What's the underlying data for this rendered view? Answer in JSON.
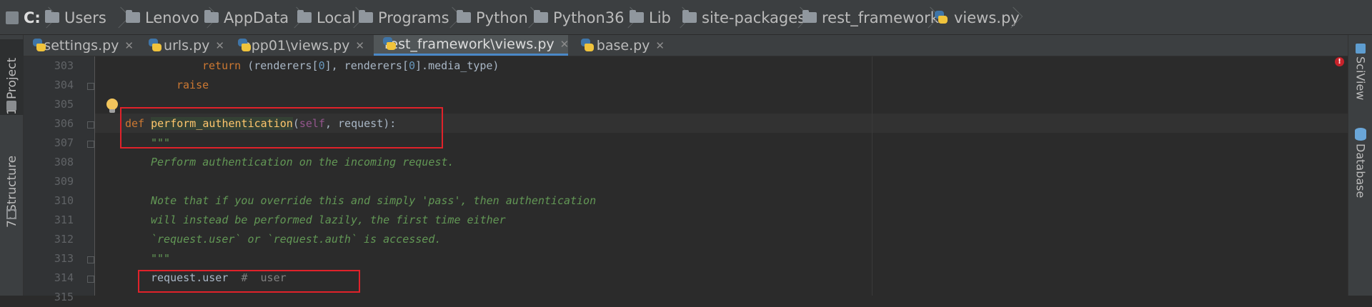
{
  "breadcrumb": [
    {
      "label": "C:",
      "icon": "drive-icon"
    },
    {
      "label": "Users",
      "icon": "folder-icon"
    },
    {
      "label": "Lenovo",
      "icon": "folder-icon"
    },
    {
      "label": "AppData",
      "icon": "folder-icon"
    },
    {
      "label": "Local",
      "icon": "folder-icon"
    },
    {
      "label": "Programs",
      "icon": "folder-icon"
    },
    {
      "label": "Python",
      "icon": "folder-icon"
    },
    {
      "label": "Python36",
      "icon": "folder-icon"
    },
    {
      "label": "Lib",
      "icon": "folder-icon"
    },
    {
      "label": "site-packages",
      "icon": "folder-icon"
    },
    {
      "label": "rest_framework",
      "icon": "folder-icon"
    },
    {
      "label": "views.py",
      "icon": "python-file-icon"
    }
  ],
  "left_tools": [
    {
      "number": "1",
      "label": "1: Project",
      "icon": "project-icon"
    },
    {
      "number": "7",
      "label": "7: Structure",
      "icon": "structure-icon"
    }
  ],
  "right_tools": [
    {
      "label": "SciView",
      "icon": "sciview-icon"
    },
    {
      "label": "Database",
      "icon": "database-icon"
    }
  ],
  "tabs": [
    {
      "label": "settings.py",
      "active": false
    },
    {
      "label": "urls.py",
      "active": false
    },
    {
      "label": "app01\\views.py",
      "active": false
    },
    {
      "label": "rest_framework\\views.py",
      "active": true
    },
    {
      "label": "base.py",
      "active": false
    }
  ],
  "tab_close_glyph": "✕",
  "line_numbers": [
    "303",
    "304",
    "305",
    "306",
    "307",
    "308",
    "309",
    "310",
    "311",
    "312",
    "313",
    "314",
    "315"
  ],
  "code": {
    "l303_kw": "return",
    "l303_rest": " (renderers[",
    "l303_n1": "0",
    "l303_mid": "], renderers[",
    "l303_n2": "0",
    "l303_end": "].media_type)",
    "l304_kw": "raise",
    "l306_kw": "def",
    "l306_fn": "perform_authentication",
    "l306_open": "(",
    "l306_self": "self",
    "l306_rest": ", request):",
    "l307_doc": "\"\"\"",
    "l308_doc": "Perform authentication on the incoming request.",
    "l310_doc": "Note that if you override this and simply 'pass', then authentication",
    "l311_doc": "will instead be performed lazily, the first time either",
    "l312_doc": "`request.user` or `request.auth` is accessed.",
    "l313_doc": "\"\"\"",
    "l314_code": "request.user",
    "l314_cmt": "#  user"
  },
  "colors": {
    "keyword": "#cc7832",
    "function": "#ffc66d",
    "docstring": "#629755",
    "number": "#6897bb",
    "self": "#94558d",
    "highlight_box": "#e0222a",
    "active_tab_underline": "#4a88c7"
  }
}
